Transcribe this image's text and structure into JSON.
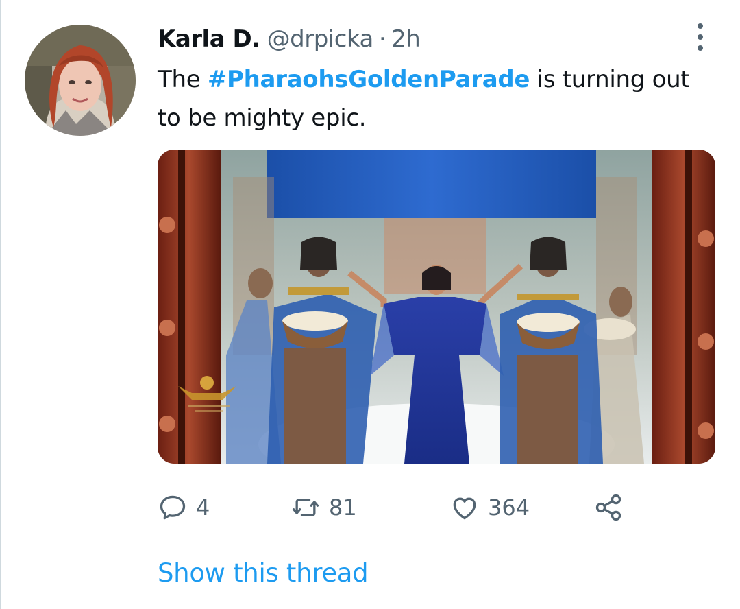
{
  "tweet": {
    "author": {
      "name": "Karla D.",
      "handle": "@drpicka",
      "separator": "·",
      "time": "2h"
    },
    "text": {
      "before": "The ",
      "hashtag": "#PharaohsGoldenParade",
      "after": " is turning out to be mighty epic."
    },
    "actions": {
      "replies": "4",
      "retweets": "81",
      "likes": "364"
    },
    "show_thread": "Show this thread"
  },
  "colors": {
    "accent": "#1d9bf0",
    "secondary_text": "#536471",
    "primary_text": "#0f1419"
  },
  "icons": [
    "more-vertical-icon",
    "reply-icon",
    "retweet-icon",
    "like-icon",
    "share-icon"
  ]
}
